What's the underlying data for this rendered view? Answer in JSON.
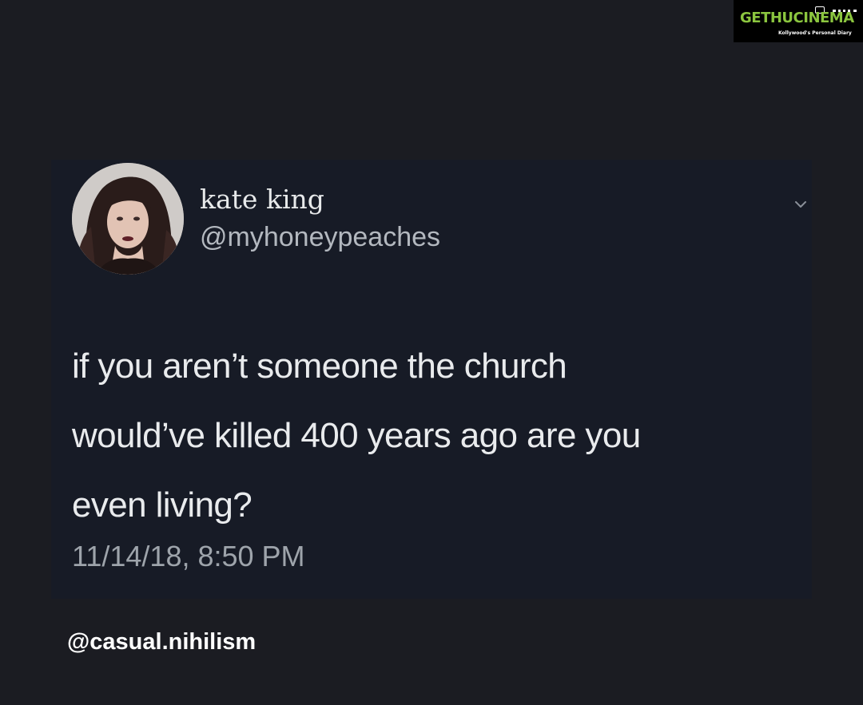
{
  "watermark": {
    "brand_left": "GETHU",
    "brand_right": "CINEMA",
    "tagline": "Kollywood's Personal Diary"
  },
  "tweet": {
    "display_name": "kate king",
    "handle": "@myhoneypeaches",
    "text_lines": [
      "if you aren’t someone the church",
      "would’ve killed 400 years ago are you",
      "even living?"
    ],
    "timestamp": "11/14/18, 8:50 PM",
    "menu_icon": "chevron-down-icon"
  },
  "credit": "@casual.nihilism",
  "colors": {
    "background": "#1b1c22",
    "card": "#171b26",
    "watermark_green": "#8bc53f"
  }
}
